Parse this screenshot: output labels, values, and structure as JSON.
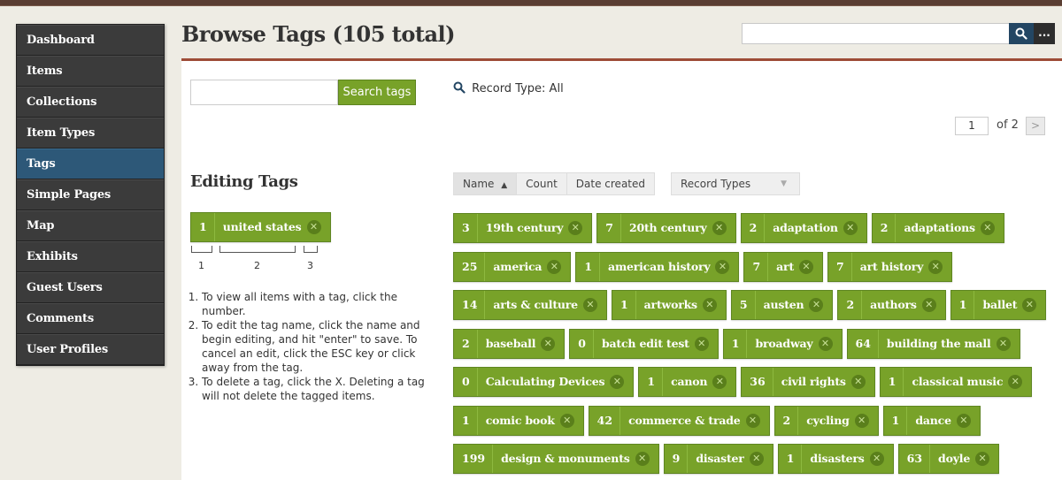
{
  "header": {
    "title": "Browse Tags (105 total)",
    "search_value": "",
    "search_button": "⚲",
    "more_button": "..."
  },
  "sidebar": {
    "items": [
      {
        "label": "Dashboard"
      },
      {
        "label": "Items"
      },
      {
        "label": "Collections"
      },
      {
        "label": "Item Types"
      },
      {
        "label": "Tags",
        "active": true
      },
      {
        "label": "Simple Pages"
      },
      {
        "label": "Map"
      },
      {
        "label": "Exhibits"
      },
      {
        "label": "Guest Users"
      },
      {
        "label": "Comments"
      },
      {
        "label": "User Profiles"
      }
    ]
  },
  "tag_search": {
    "value": "",
    "button_label": "Search tags"
  },
  "filter": {
    "record_type_label": "Record Type: All"
  },
  "pagination": {
    "current_page": "1",
    "of_label": "of 2",
    "next_label": ">"
  },
  "editing": {
    "title": "Editing Tags",
    "sample_tag": {
      "count": "1",
      "name": "united states"
    },
    "diagram_numbers": [
      "1",
      "2",
      "3"
    ],
    "instructions": [
      "To view all items with a tag, click the number.",
      "To edit the tag name, click the name and begin editing, and hit \"enter\" to save. To cancel an edit, click the ESC key or click away from the tag.",
      "To delete a tag, click the X. Deleting a tag will not delete the tagged items."
    ]
  },
  "sort": {
    "items": [
      "Name",
      "Count",
      "Date created"
    ],
    "active_indicator": "▲",
    "record_types_label": "Record Types",
    "record_types_caret": "▼"
  },
  "tags": [
    {
      "count": "3",
      "name": "19th century"
    },
    {
      "count": "7",
      "name": "20th century"
    },
    {
      "count": "2",
      "name": "adaptation"
    },
    {
      "count": "2",
      "name": "adaptations"
    },
    {
      "count": "25",
      "name": "america"
    },
    {
      "count": "1",
      "name": "american history"
    },
    {
      "count": "7",
      "name": "art"
    },
    {
      "count": "7",
      "name": "art history"
    },
    {
      "count": "14",
      "name": "arts & culture"
    },
    {
      "count": "1",
      "name": "artworks"
    },
    {
      "count": "5",
      "name": "austen"
    },
    {
      "count": "2",
      "name": "authors"
    },
    {
      "count": "1",
      "name": "ballet"
    },
    {
      "count": "2",
      "name": "baseball"
    },
    {
      "count": "0",
      "name": "batch edit test"
    },
    {
      "count": "1",
      "name": "broadway"
    },
    {
      "count": "64",
      "name": "building the mall"
    },
    {
      "count": "0",
      "name": "Calculating Devices"
    },
    {
      "count": "1",
      "name": "canon"
    },
    {
      "count": "36",
      "name": "civil rights"
    },
    {
      "count": "1",
      "name": "classical music"
    },
    {
      "count": "1",
      "name": "comic book"
    },
    {
      "count": "42",
      "name": "commerce & trade"
    },
    {
      "count": "2",
      "name": "cycling"
    },
    {
      "count": "1",
      "name": "dance"
    },
    {
      "count": "199",
      "name": "design & monuments"
    },
    {
      "count": "9",
      "name": "disaster"
    },
    {
      "count": "1",
      "name": "disasters"
    },
    {
      "count": "63",
      "name": "doyle"
    }
  ],
  "tag_rows": [
    [
      0,
      1,
      2,
      3
    ],
    [
      4,
      5,
      6,
      7
    ],
    [
      8,
      9,
      10,
      11,
      12
    ],
    [
      13,
      14,
      15,
      16
    ],
    [
      17,
      18,
      19,
      20
    ],
    [
      21,
      22,
      23,
      24
    ],
    [
      25,
      26,
      27,
      28
    ]
  ],
  "colors": {
    "tag_green": "#78a229",
    "nav_active": "#2d5878",
    "accent_rule": "#9e4c37"
  }
}
